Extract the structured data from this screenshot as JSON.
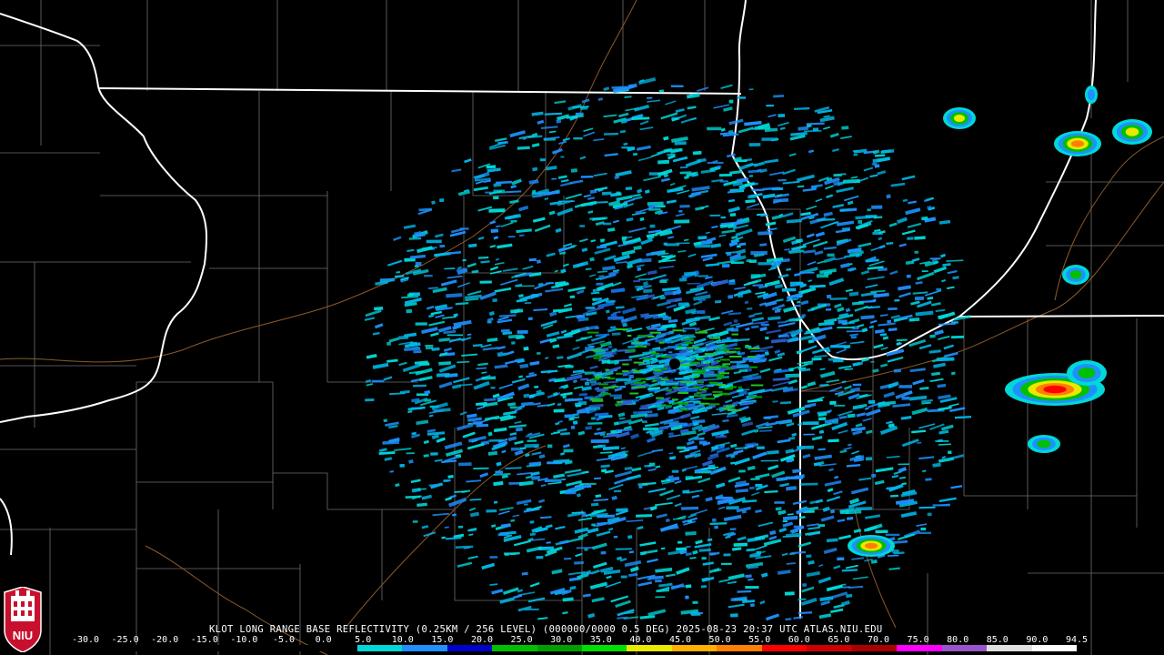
{
  "product": {
    "caption": "KLOT LONG RANGE BASE REFLECTIVITY (0.25KM / 256 LEVEL) (000000/0000 0.5 DEG) 2025-08-23 20:37 UTC  ATLAS.NIU.EDU"
  },
  "logo": {
    "text": "NIU"
  },
  "scale": {
    "labels": [
      "-30.0",
      "-25.0",
      "-20.0",
      "-15.0",
      "-10.0",
      "-5.0",
      "0.0",
      "5.0",
      "10.0",
      "15.0",
      "20.0",
      "25.0",
      "30.0",
      "35.0",
      "40.0",
      "45.0",
      "50.0",
      "55.0",
      "60.0",
      "65.0",
      "70.0",
      "75.0",
      "80.0",
      "85.0",
      "90.0",
      "94.5"
    ],
    "colors": [
      "#000000",
      "#000000",
      "#000000",
      "#000000",
      "#000000",
      "#000000",
      "#00d8d8",
      "#1e90ff",
      "#0000cd",
      "#00c000",
      "#00a000",
      "#00e000",
      "#e8e800",
      "#ffb000",
      "#ff8000",
      "#ff0000",
      "#cc0000",
      "#aa0000",
      "#ff00ff",
      "#9955cc",
      "#e0e0e0",
      "#ffffff"
    ]
  },
  "colors": {
    "background": "#000000",
    "county_lines": "#6e6e6e",
    "state_lines": "#ffffff",
    "rivers": "#8b5a2b"
  }
}
